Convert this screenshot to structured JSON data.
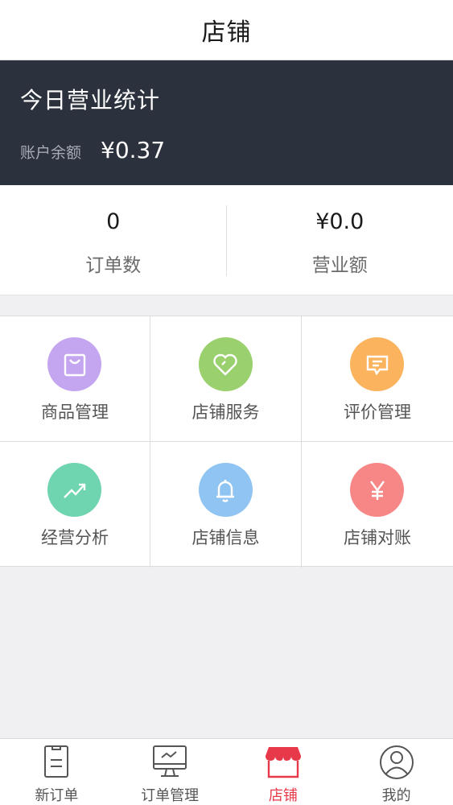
{
  "header": {
    "title": "店铺"
  },
  "stats": {
    "heading": "今日营业统计",
    "balance_label": "账户余额",
    "balance_value": "¥0.37"
  },
  "summary": [
    {
      "value": "0",
      "label": "订单数"
    },
    {
      "value": "¥0.0",
      "label": "营业额"
    }
  ],
  "grid": [
    {
      "label": "商品管理",
      "icon": "shopping-bag-icon",
      "color": "#c4a5f0"
    },
    {
      "label": "店铺服务",
      "icon": "heart-icon",
      "color": "#9bd06e"
    },
    {
      "label": "评价管理",
      "icon": "message-icon",
      "color": "#fbb35d"
    },
    {
      "label": "经营分析",
      "icon": "trend-icon",
      "color": "#6fd4b0"
    },
    {
      "label": "店铺信息",
      "icon": "bell-icon",
      "color": "#8fc4f3"
    },
    {
      "label": "店铺对账",
      "icon": "yen-icon",
      "color": "#f78787"
    }
  ],
  "tabs": [
    {
      "label": "新订单",
      "icon": "clipboard-icon",
      "active": false
    },
    {
      "label": "订单管理",
      "icon": "monitor-chart-icon",
      "active": false
    },
    {
      "label": "店铺",
      "icon": "store-icon",
      "active": true
    },
    {
      "label": "我的",
      "icon": "user-icon",
      "active": false
    }
  ],
  "colors": {
    "accent": "#e8394a",
    "header_dark": "#2c323d"
  }
}
